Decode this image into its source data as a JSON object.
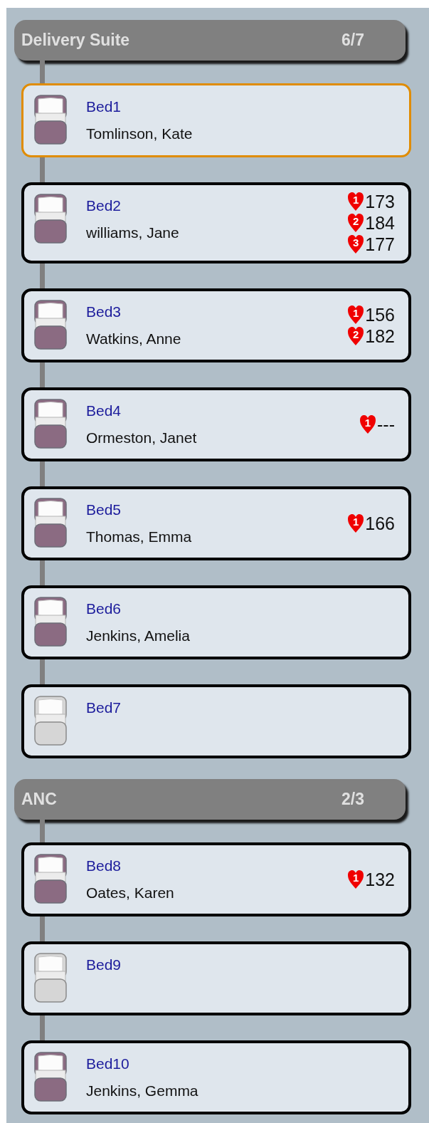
{
  "wards": [
    {
      "name": "Delivery Suite",
      "count": "6/7",
      "beds": [
        {
          "label": "Bed1",
          "patient": "Tomlinson, Kate",
          "occupied": true,
          "selected": true
        },
        {
          "label": "Bed2",
          "patient": "williams, Jane",
          "occupied": true,
          "selected": false,
          "readings": [
            {
              "index": "1",
              "value": "173"
            },
            {
              "index": "2",
              "value": "184"
            },
            {
              "index": "3",
              "value": "177"
            }
          ]
        },
        {
          "label": "Bed3",
          "patient": "Watkins, Anne",
          "occupied": true,
          "selected": false,
          "readings": [
            {
              "index": "1",
              "value": "156"
            },
            {
              "index": "2",
              "value": "182"
            }
          ]
        },
        {
          "label": "Bed4",
          "patient": "Ormeston, Janet",
          "occupied": true,
          "selected": false,
          "readings": [
            {
              "index": "1",
              "value": "---"
            }
          ]
        },
        {
          "label": "Bed5",
          "patient": "Thomas, Emma",
          "occupied": true,
          "selected": false,
          "readings": [
            {
              "index": "1",
              "value": "166"
            }
          ]
        },
        {
          "label": "Bed6",
          "patient": "Jenkins, Amelia",
          "occupied": true,
          "selected": false
        },
        {
          "label": "Bed7",
          "occupied": false,
          "selected": false
        }
      ]
    },
    {
      "name": "ANC",
      "count": "2/3",
      "beds": [
        {
          "label": "Bed8",
          "patient": "Oates, Karen",
          "occupied": true,
          "selected": false,
          "readings": [
            {
              "index": "1",
              "value": "132"
            }
          ]
        },
        {
          "label": "Bed9",
          "occupied": false,
          "selected": false
        },
        {
          "label": "Bed10",
          "patient": "Jenkins, Gemma",
          "occupied": true,
          "selected": false
        }
      ]
    }
  ]
}
